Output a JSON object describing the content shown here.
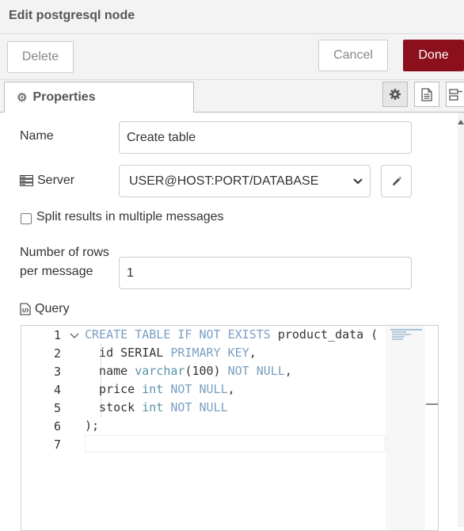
{
  "header": {
    "title": "Edit postgresql node"
  },
  "toolbar": {
    "delete_label": "Delete",
    "cancel_label": "Cancel",
    "done_label": "Done"
  },
  "tabs": {
    "properties_label": "Properties",
    "gear_icon": "⚙"
  },
  "form": {
    "name_label": "Name",
    "name_value": "Create table",
    "server_label": "Server",
    "server_value": "USER@HOST:PORT/DATABASE",
    "split_label": "Split results in multiple messages",
    "rows_label_1": "Number of rows",
    "rows_label_2": "per message",
    "rows_value": "1",
    "query_label": "Query"
  },
  "editor": {
    "line_numbers": [
      "1",
      "2",
      "3",
      "4",
      "5",
      "6",
      "7"
    ],
    "lines": [
      "CREATE TABLE IF NOT EXISTS product_data (",
      "  id SERIAL PRIMARY KEY,",
      "  name varchar(100) NOT NULL,",
      "  price int NOT NULL,",
      "  stock int NOT NULL",
      ");",
      ""
    ]
  },
  "colors": {
    "done_bg": "#8c101c",
    "keyword": "#7b9fc4",
    "type": "#5a93a8"
  }
}
